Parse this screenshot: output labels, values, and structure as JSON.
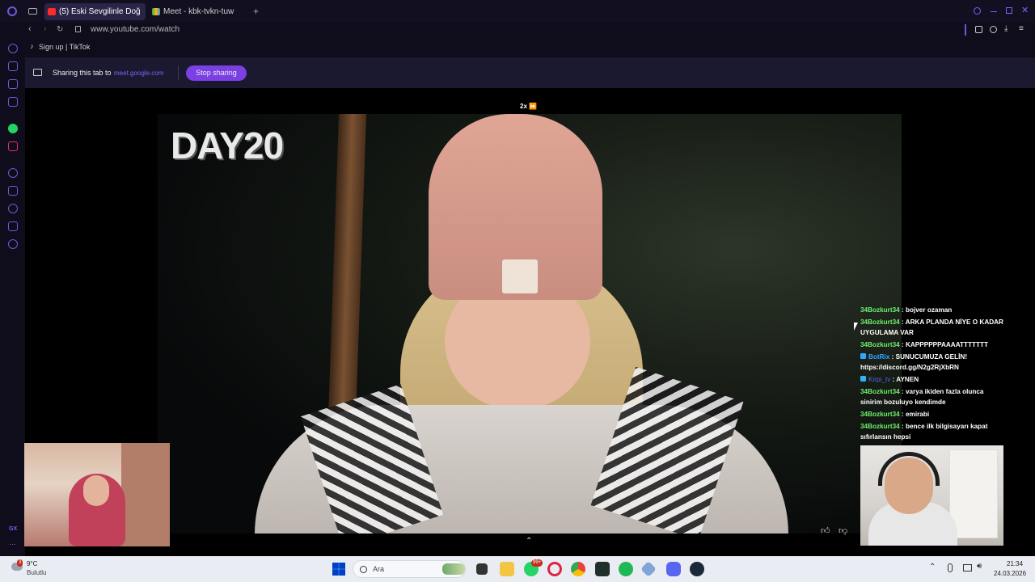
{
  "browser": {
    "tabs": [
      {
        "label": "(5) Eski Sevgilinle Doğ",
        "active": true,
        "icon": "youtube-icon"
      },
      {
        "label": "Meet - kbk-tvkn-tuw",
        "active": false,
        "icon": "meet-icon"
      }
    ],
    "url": "www.youtube.com/watch",
    "bookmark": "Sign up | TikTok"
  },
  "share_bar": {
    "label": "Sharing this tab to",
    "host": "meet.google.com",
    "stop_label": "Stop sharing"
  },
  "player": {
    "speed": "2x ⏩",
    "overlay_title": "DAY20"
  },
  "chat": [
    {
      "user": "34Bozkurt34",
      "text": " : bojver ozaman"
    },
    {
      "user": "34Bozkurt34",
      "text": " : ARKA PLANDA NİYE O KADAR UYGULAMA VAR"
    },
    {
      "user": "34Bozkurt34",
      "text": " : KAPPPPPPAAAATTTTTTT"
    },
    {
      "user": "BotRix",
      "text": " : SUNUCUMUZA GELİN! https://discord.gg/N2g2RjXbRN",
      "kind": "bot"
    },
    {
      "user": "Kirpi_tv",
      "text": " : AYNEN",
      "kind": "kirpi"
    },
    {
      "user": "34Bozkurt34",
      "text": " : varya ikiden fazla olunca sinirim bozuluyo kendimde"
    },
    {
      "user": "34Bozkurt34",
      "text": " : emirabi"
    },
    {
      "user": "34Bozkurt34",
      "text": " : bence ilk bilgisayarı kapat sıfırlansın hepsi"
    }
  ],
  "taskbar": {
    "weather_temp": "9°C",
    "weather_desc": "Bulutlu",
    "search_placeholder": "Ara",
    "badge_weather": "3",
    "badge_whatsapp": "99+",
    "time": "21:34",
    "date": "24.03.2026"
  },
  "colors": {
    "accent": "#7b3fe4",
    "chat_user": "#6cf06c",
    "taskbar_bg": "#e9ecf3"
  }
}
